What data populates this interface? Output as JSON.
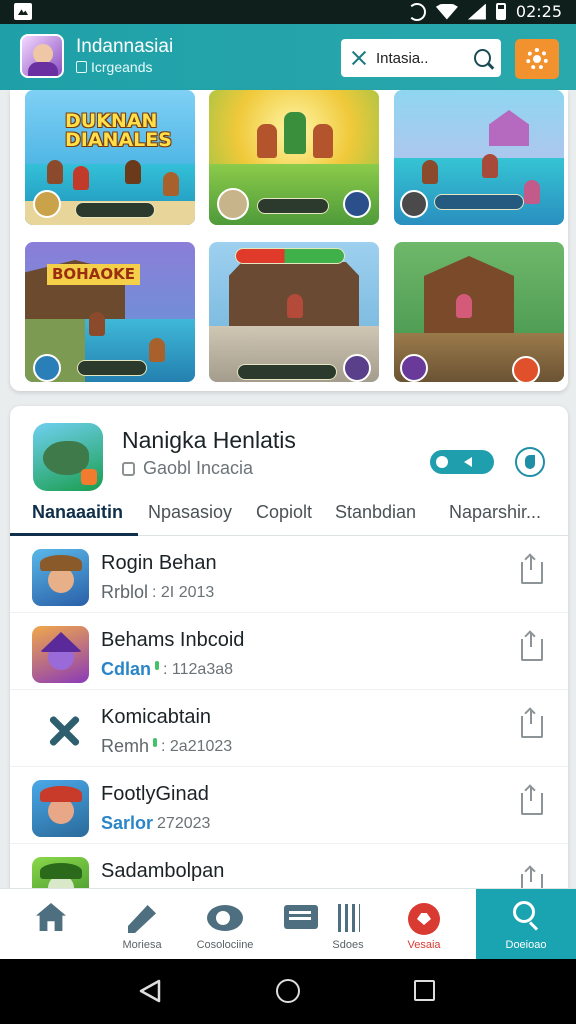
{
  "status_bar": {
    "time": "02:25"
  },
  "app_bar": {
    "title": "Indannasiai",
    "subtitle": "Icrgeands",
    "search": {
      "value": "Intasia..",
      "placeholder": "Intasia.."
    }
  },
  "game_grid": {
    "tiles": [
      {
        "banner": "DUKNAN\nDIANALES",
        "accent": "#2f8fd8"
      },
      {
        "banner": "",
        "accent": "#f0c93a"
      },
      {
        "banner": "",
        "accent": "#7b56c8"
      },
      {
        "banner": "BOHAOKE",
        "accent": "#6b9be0"
      },
      {
        "banner": "",
        "accent": "#4b8a4a"
      },
      {
        "banner": "",
        "accent": "#6d5a3a"
      }
    ]
  },
  "detail": {
    "title": "Nanigka Henlatis",
    "subtitle": "Gaobl Incacia",
    "tabs": [
      {
        "label": "Nanaaaitin",
        "active": true
      },
      {
        "label": "Npasasioy",
        "active": false
      },
      {
        "label": "Copiolt",
        "active": false
      },
      {
        "label": "Stanbdian",
        "active": false
      },
      {
        "label": "Naparshir...",
        "active": false
      }
    ]
  },
  "list": {
    "items": [
      {
        "title": "Rogin Behan",
        "tag": "Rrblol",
        "tag_style": "gray",
        "date": ": 2I 2013",
        "icon": "cowboy-icon"
      },
      {
        "title": "Behams Inbcoid",
        "tag": "Cdlan",
        "tag_style": "blue",
        "date": ": 112a3a8",
        "icon": "wizard-icon"
      },
      {
        "title": "Komicabtain",
        "tag": "Remh",
        "tag_style": "gray",
        "date": ": 2a21023",
        "icon": "cross-icon"
      },
      {
        "title": "FootlyGinad",
        "tag": "Sarlor",
        "tag_style": "blue",
        "date": "272023",
        "icon": "pirate-icon"
      },
      {
        "title": "Sadambolpan",
        "tag": "",
        "tag_style": "gray",
        "date": "",
        "icon": "goblin-icon"
      }
    ]
  },
  "bottom_nav": {
    "items": [
      {
        "label": "",
        "icon": "home-icon"
      },
      {
        "label": "Moriesa",
        "icon": "pen-icon"
      },
      {
        "label": "Cosolociine",
        "icon": "chat-icon"
      },
      {
        "label": "",
        "icon": "mail-icon"
      },
      {
        "label": "Sdoes",
        "icon": "bars-icon"
      },
      {
        "label": "Vesaia",
        "icon": "bubble-icon"
      },
      {
        "label": "Doeioao",
        "icon": "search-icon"
      }
    ]
  },
  "colors": {
    "app_bar": "#1fa0a8",
    "accent_orange": "#f2922e",
    "active_nav": "#1aa3b1",
    "link_blue": "#2a86c8",
    "red": "#d93b32"
  }
}
